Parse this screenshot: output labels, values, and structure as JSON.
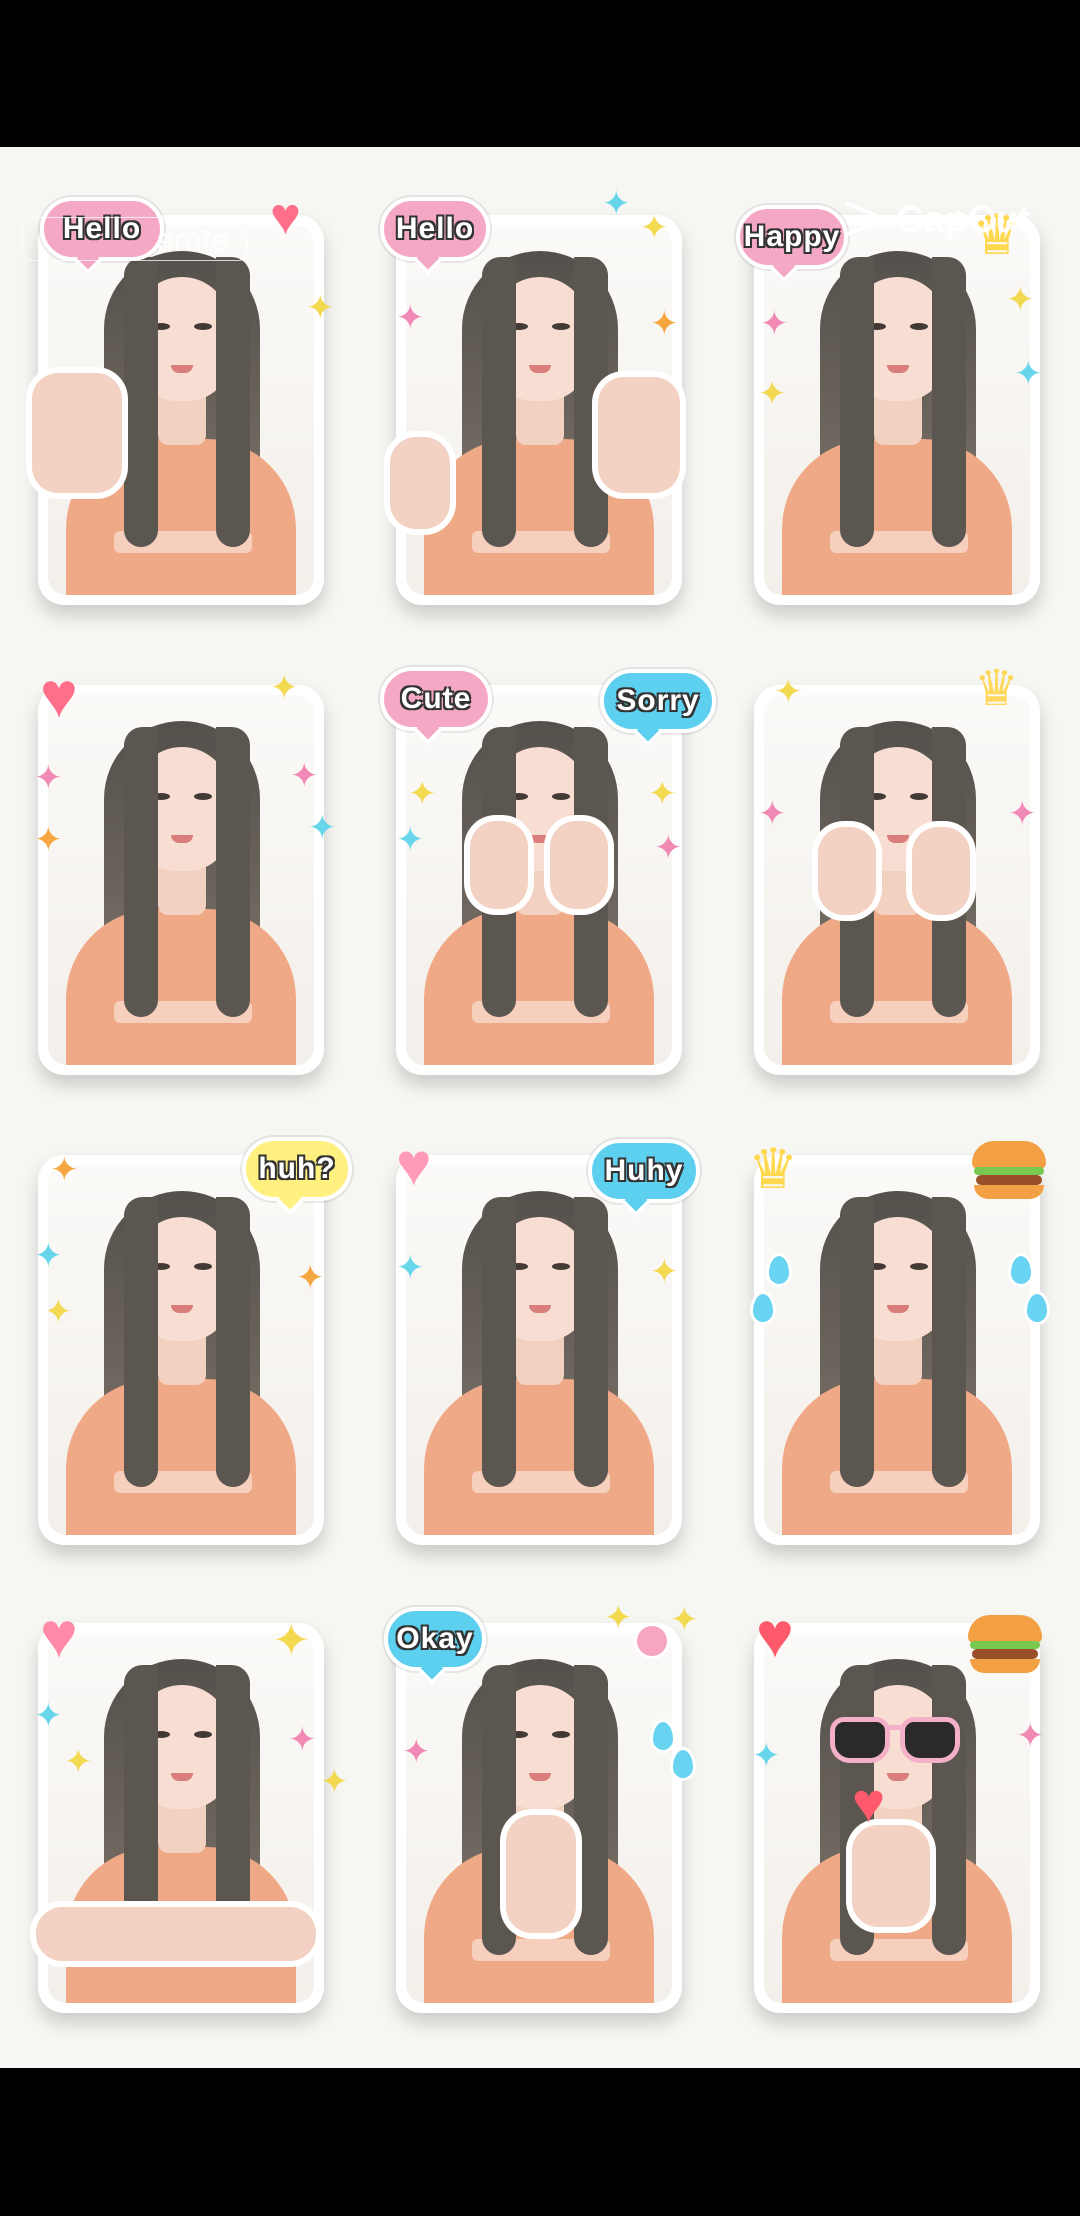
{
  "watermarks": {
    "left_text": "erate",
    "right_text": "CapCut"
  },
  "bubbles": {
    "r1c1": "Hello",
    "r1c2": "Hello",
    "r1c3": "Happy",
    "r2c2a": "Cute",
    "r2c2b": "Sorry",
    "r3c1": "huh?",
    "r3c2": "Huhy",
    "r4c2": "Okay"
  },
  "icons": {
    "heart": "♥",
    "sparkle": "✦",
    "crown": "♛",
    "hamburger": "hamburger",
    "water-drop": "drop"
  },
  "colors": {
    "background": "#f6f6f3",
    "shirt": "#f0a987",
    "pink_bubble": "#f5a8c6",
    "blue_bubble": "#5ed0ef",
    "yellow_bubble": "#fff07f"
  }
}
